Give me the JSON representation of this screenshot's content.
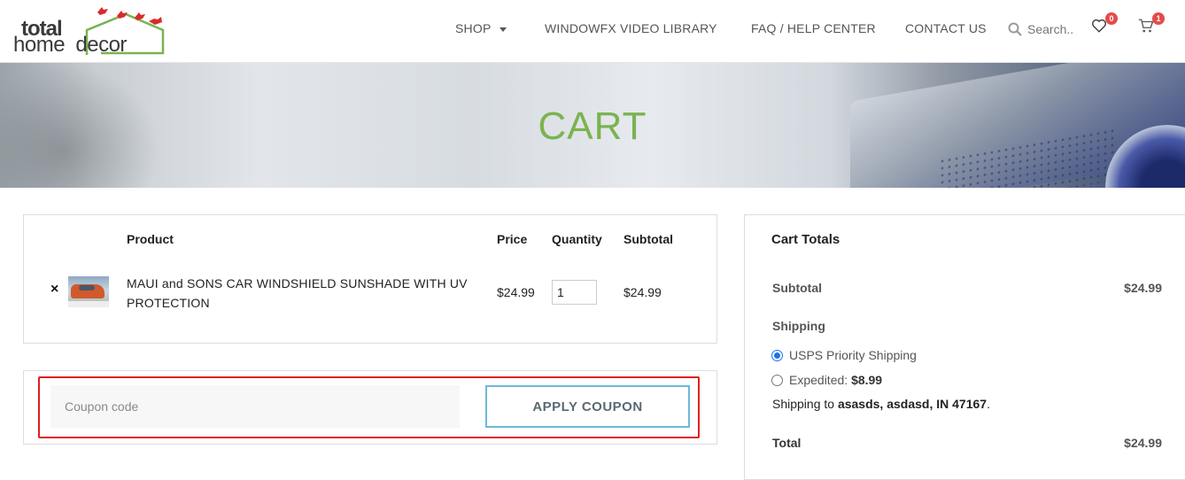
{
  "header": {
    "logo_line1": "total",
    "logo_line2a": "home",
    "logo_line2b": "decor",
    "nav": {
      "shop": "SHOP",
      "video": "WINDOWFX VIDEO LIBRARY",
      "faq": "FAQ / HELP CENTER",
      "contact": "CONTACT US"
    },
    "search_placeholder": "Search..",
    "wishlist_count": "0",
    "cart_count": "1"
  },
  "banner": {
    "title": "CART"
  },
  "cart": {
    "headers": {
      "product": "Product",
      "price": "Price",
      "quantity": "Quantity",
      "subtotal": "Subtotal"
    },
    "items": [
      {
        "remove": "×",
        "name": "MAUI and SONS CAR WINDSHIELD SUNSHADE WITH UV PROTECTION",
        "price": "$24.99",
        "quantity": "1",
        "subtotal": "$24.99"
      }
    ]
  },
  "coupon": {
    "placeholder": "Coupon code",
    "button": "APPLY COUPON"
  },
  "totals": {
    "title": "Cart Totals",
    "subtotal_label": "Subtotal",
    "subtotal_value": "$24.99",
    "shipping_label": "Shipping",
    "option1": "USPS Priority Shipping",
    "option2_label": "Expedited: ",
    "option2_price": "$8.99",
    "ship_to_prefix": "Shipping to ",
    "ship_to_address": "asasds, asdasd, IN 47167",
    "ship_to_suffix": ".",
    "total_label": "Total",
    "total_value": "$24.99"
  },
  "colors": {
    "brand_green": "#7bb350",
    "accent_blue": "#6cb9d6",
    "badge_red": "#e54b4b",
    "highlight_red": "#e02020"
  }
}
